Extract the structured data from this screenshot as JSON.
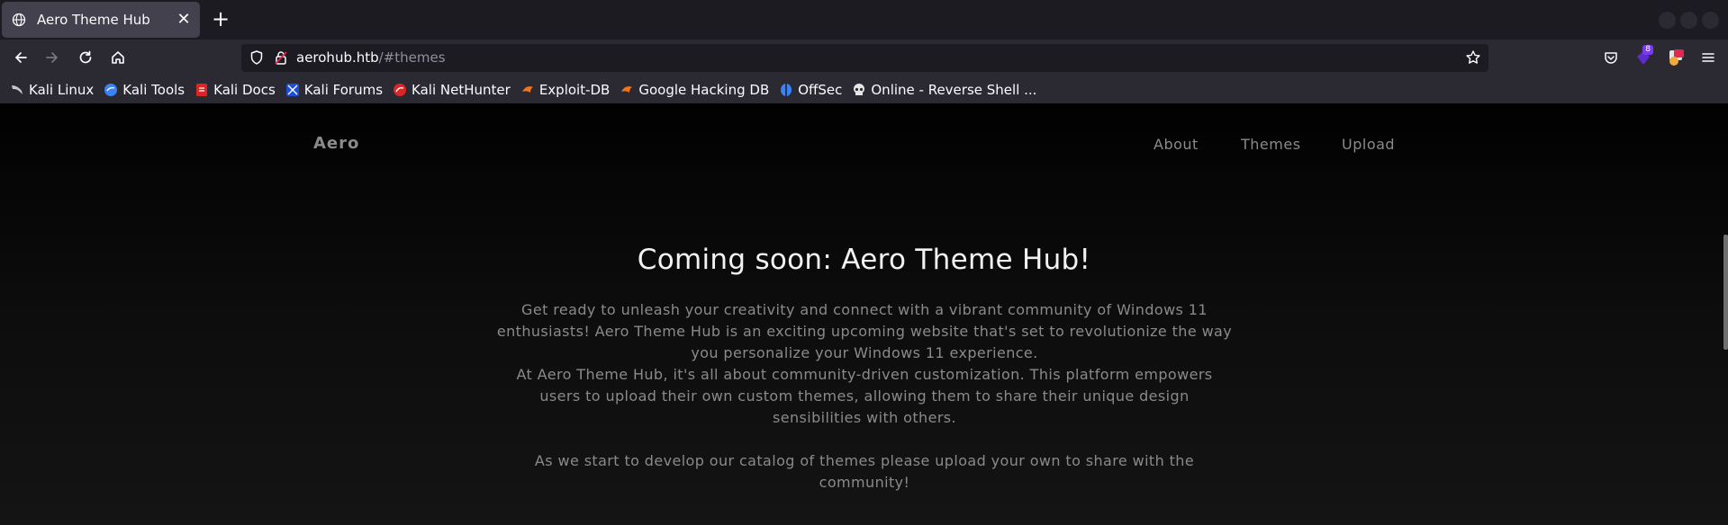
{
  "browser": {
    "tab": {
      "title": "Aero Theme Hub",
      "favicon": "globe-icon",
      "close_glyph": "✕"
    },
    "new_tab_glyph": "+",
    "url": {
      "host": "aerohub.htb",
      "path": "/#themes"
    },
    "bookmarks": [
      {
        "label": "Kali Linux",
        "icon": "kali-dragon-icon",
        "color": "#c9c9c9"
      },
      {
        "label": "Kali Tools",
        "icon": "kali-tools-icon",
        "color": "#3b82f6"
      },
      {
        "label": "Kali Docs",
        "icon": "kali-docs-icon",
        "color": "#dc2626"
      },
      {
        "label": "Kali Forums",
        "icon": "kali-forums-icon",
        "color": "#1d4ed8"
      },
      {
        "label": "Kali NetHunter",
        "icon": "nethunter-icon",
        "color": "#dc2626"
      },
      {
        "label": "Exploit-DB",
        "icon": "exploitdb-icon",
        "color": "#f97316"
      },
      {
        "label": "Google Hacking DB",
        "icon": "ghdb-icon",
        "color": "#f97316"
      },
      {
        "label": "OffSec",
        "icon": "offsec-icon",
        "color": "#3b82f6"
      },
      {
        "label": "Online - Reverse Shell ...",
        "icon": "skull-icon",
        "color": "#e5e5e5"
      }
    ],
    "extension_badge": "8"
  },
  "site": {
    "brand": "Aero",
    "nav": [
      "About",
      "Themes",
      "Upload"
    ],
    "hero": {
      "title": "Coming soon: Aero Theme Hub!",
      "paragraph1": "Get ready to unleash your creativity and connect with a vibrant community of Windows 11 enthusiasts! Aero Theme Hub is an exciting upcoming website that's set to revolutionize the way you personalize your Windows 11 experience.",
      "paragraph2": "At Aero Theme Hub, it's all about community-driven customization. This platform empowers users to upload their own custom themes, allowing them to share their unique design sensibilities with others.",
      "paragraph3": "As we start to develop our catalog of themes please upload your own to share with the community!"
    }
  },
  "colors": {
    "tabstrip": "#1c1b22",
    "toolbar": "#2b2a33",
    "page_bg": "#0f0f0f",
    "muted_text": "#8a8a8a",
    "heading_text": "#f2f2f2"
  }
}
